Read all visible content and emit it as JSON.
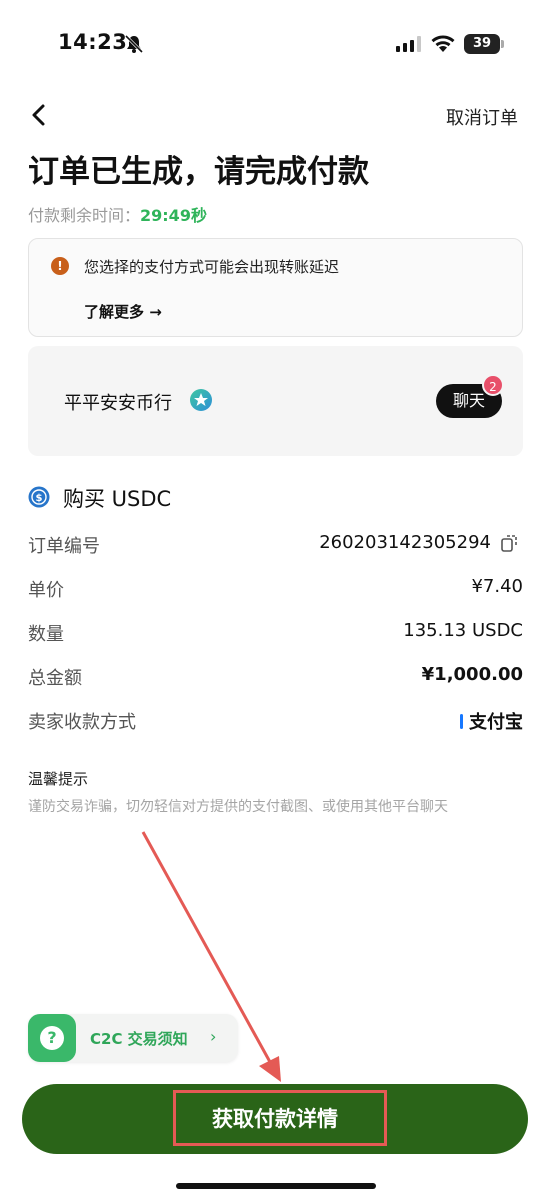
{
  "status_bar": {
    "time": "14:23",
    "battery": "39"
  },
  "nav": {
    "cancel_label": "取消订单"
  },
  "header": {
    "title": "订单已生成，请完成付款",
    "timer_label": "付款剩余时间：",
    "timer_value": "29:49秒"
  },
  "notice": {
    "text": "您选择的支付方式可能会出现转账延迟",
    "learn_more": "了解更多 →"
  },
  "merchant": {
    "name": "平平安安币行",
    "chat_label": "聊天",
    "chat_badge": "2"
  },
  "order": {
    "heading": "购买 USDC",
    "rows": [
      {
        "label": "订单编号",
        "value": "260203142305294"
      },
      {
        "label": "单价",
        "value": "¥7.40"
      },
      {
        "label": "数量",
        "value": "135.13 USDC"
      },
      {
        "label": "总金额",
        "value": "¥1,000.00"
      },
      {
        "label": "卖家收款方式",
        "value": "支付宝"
      }
    ]
  },
  "tips": {
    "title": "温馨提示",
    "text": "谨防交易诈骗，切勿轻信对方提供的支付截图、或使用其他平台聊天"
  },
  "help": {
    "icon_text": "?",
    "label": "C2C 交易须知",
    "chevron": "›"
  },
  "primary_button": {
    "label": "获取付款详情"
  },
  "colors": {
    "timer": "#2fb45a",
    "primary": "#2a6418",
    "annotation": "#e45a55",
    "warning": "#c85f1a"
  }
}
